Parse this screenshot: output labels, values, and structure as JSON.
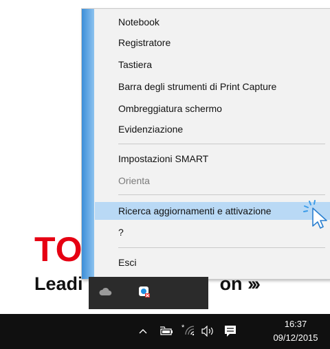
{
  "background": {
    "logo_text": "TO",
    "tagline_text": "Leadi",
    "tagline_tail": "on",
    "tagline_chevrons": "›››"
  },
  "context_menu": {
    "items": [
      {
        "label": "Notebook",
        "state": "normal"
      },
      {
        "label": "Registratore",
        "state": "normal"
      },
      {
        "label": "Tastiera",
        "state": "normal"
      },
      {
        "label": "Barra degli strumenti di Print Capture",
        "state": "normal"
      },
      {
        "label": "Ombreggiatura schermo",
        "state": "normal"
      },
      {
        "label": "Evidenziazione",
        "state": "normal"
      },
      {
        "label": "Impostazioni SMART",
        "state": "normal"
      },
      {
        "label": "Orienta",
        "state": "disabled"
      },
      {
        "label": "Ricerca aggiornamenti e attivazione",
        "state": "highlighted"
      },
      {
        "label": "?",
        "state": "normal"
      },
      {
        "label": "Esci",
        "state": "normal"
      }
    ]
  },
  "tray_flyout": {
    "icons": [
      "onedrive-cloud-icon",
      "smart-board-icon"
    ]
  },
  "taskbar": {
    "tray_icons": [
      "chevron-up-icon",
      "battery-icon",
      "wifi-icon",
      "speaker-icon",
      "action-center-icon"
    ],
    "time": "16:37",
    "date": "09/12/2015"
  },
  "colors": {
    "menu_bg": "#f2f2f2",
    "highlight": "#b9d9f5",
    "strip": "#3c8ed8",
    "taskbar": "#101010",
    "logo_red": "#e60012"
  }
}
